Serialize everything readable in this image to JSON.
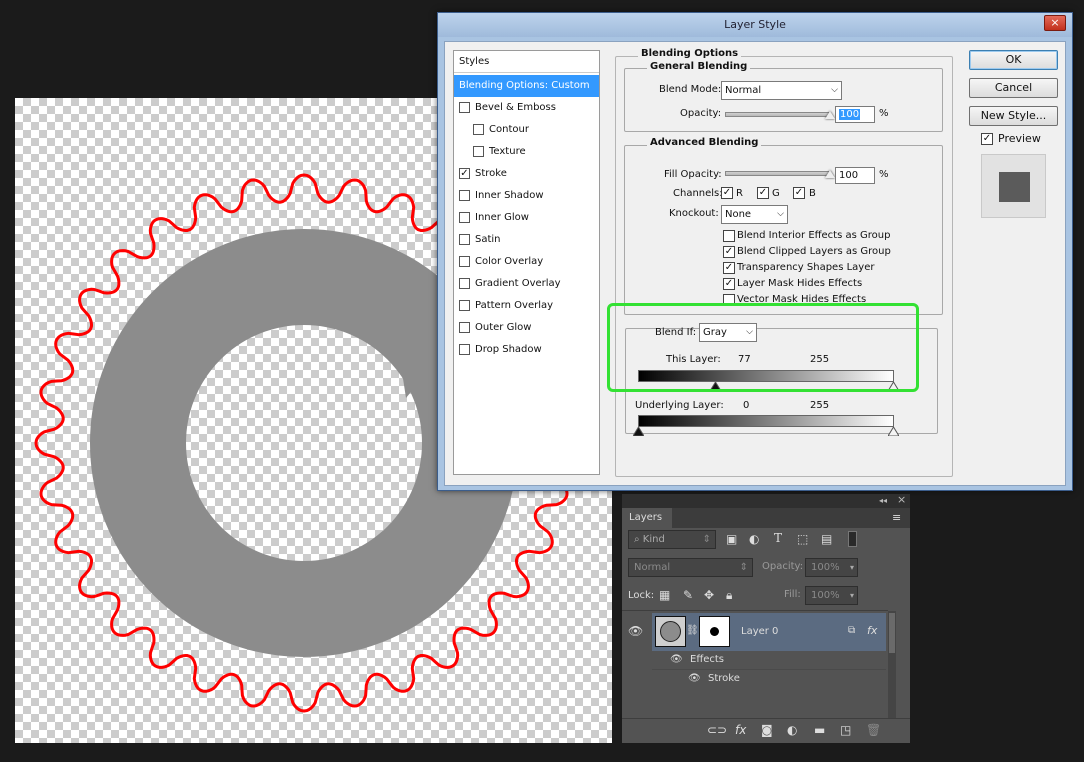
{
  "dialog": {
    "title": "Layer Style",
    "close_icon": "×",
    "buttons": {
      "ok": "OK",
      "cancel": "Cancel",
      "new_style": "New Style..."
    },
    "preview_label": "Preview",
    "preview_checked": true
  },
  "styles_list": {
    "header": "Styles",
    "items": [
      {
        "label": "Blending Options: Custom",
        "checkbox": false,
        "checked": false,
        "selected": true
      },
      {
        "label": "Bevel & Emboss",
        "checkbox": true,
        "checked": false
      },
      {
        "label": "Contour",
        "checkbox": true,
        "checked": false,
        "indent": true
      },
      {
        "label": "Texture",
        "checkbox": true,
        "checked": false,
        "indent": true
      },
      {
        "label": "Stroke",
        "checkbox": true,
        "checked": true
      },
      {
        "label": "Inner Shadow",
        "checkbox": true,
        "checked": false
      },
      {
        "label": "Inner Glow",
        "checkbox": true,
        "checked": false
      },
      {
        "label": "Satin",
        "checkbox": true,
        "checked": false
      },
      {
        "label": "Color Overlay",
        "checkbox": true,
        "checked": false
      },
      {
        "label": "Gradient Overlay",
        "checkbox": true,
        "checked": false
      },
      {
        "label": "Pattern Overlay",
        "checkbox": true,
        "checked": false
      },
      {
        "label": "Outer Glow",
        "checkbox": true,
        "checked": false
      },
      {
        "label": "Drop Shadow",
        "checkbox": true,
        "checked": false
      }
    ]
  },
  "blending": {
    "section_title": "Blending Options",
    "general": {
      "title": "General Blending",
      "blend_mode_label": "Blend Mode:",
      "blend_mode_value": "Normal",
      "opacity_label": "Opacity:",
      "opacity_value": "100",
      "percent": "%"
    },
    "advanced": {
      "title": "Advanced Blending",
      "fill_opacity_label": "Fill Opacity:",
      "fill_opacity_value": "100",
      "percent": "%",
      "channels_label": "Channels:",
      "channels": [
        "R",
        "G",
        "B"
      ],
      "knockout_label": "Knockout:",
      "knockout_value": "None",
      "options": [
        {
          "label": "Blend Interior Effects as Group",
          "checked": false
        },
        {
          "label": "Blend Clipped Layers as Group",
          "checked": true
        },
        {
          "label": "Transparency Shapes Layer",
          "checked": true
        },
        {
          "label": "Layer Mask Hides Effects",
          "checked": true
        },
        {
          "label": "Vector Mask Hides Effects",
          "checked": false
        }
      ]
    },
    "blend_if": {
      "label": "Blend If:",
      "value": "Gray",
      "this_layer_label": "This Layer:",
      "this_layer_low": "77",
      "this_layer_high": "255",
      "underlying_label": "Underlying Layer:",
      "underlying_low": "0",
      "underlying_high": "255"
    }
  },
  "layers_panel": {
    "tab_label": "Layers",
    "collapse_icon": "◂◂",
    "close_icon": "×",
    "menu_icon": "≡",
    "filter_kind": "Kind",
    "blend_mode": "Normal",
    "opacity_label": "Opacity:",
    "opacity_value": "100%",
    "lock_label": "Lock:",
    "fill_label": "Fill:",
    "fill_value": "100%",
    "layer_name": "Layer 0",
    "fx_badge": "fx",
    "effects_label": "Effects",
    "stroke_label": "Stroke",
    "footer_icons": [
      "link-icon",
      "fx-icon",
      "mask-icon",
      "adjustment-icon",
      "folder-icon",
      "new-layer-icon",
      "trash-icon"
    ]
  },
  "colors": {
    "highlight": "#33e133",
    "stroke_red": "#ff0000",
    "ring_gray": "#8c8c8c",
    "selection_blue": "#3399ff"
  }
}
